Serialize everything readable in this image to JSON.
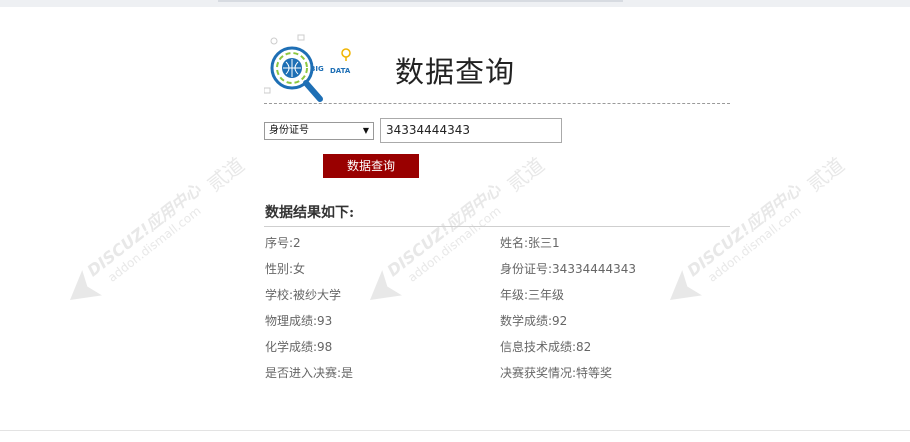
{
  "page": {
    "title": "数据查询"
  },
  "logo": {
    "big_text": "BIG",
    "data_text": "DATA"
  },
  "search": {
    "select_value": "身份证号",
    "input_value": "34334444343",
    "button_label": "数据查询"
  },
  "results": {
    "heading": "数据结果如下:",
    "rows": [
      {
        "left": "序号:2",
        "right": "姓名:张三1"
      },
      {
        "left": "性别:女",
        "right": "身份证号:34334444343"
      },
      {
        "left": "学校:被纱大学",
        "right": "年级:三年级"
      },
      {
        "left": "物理成绩:93",
        "right": "数学成绩:92"
      },
      {
        "left": "化学成绩:98",
        "right": "信息技术成绩:82"
      },
      {
        "left": "是否进入决赛:是",
        "right": "决赛获奖情况:特等奖"
      }
    ]
  },
  "watermark": {
    "brand": "DISCUZ!应用中心",
    "url": "addon.dismall.com",
    "mark": "贰道"
  },
  "colors": {
    "button_bg": "#990000",
    "title": "#222222",
    "text": "#666666"
  }
}
